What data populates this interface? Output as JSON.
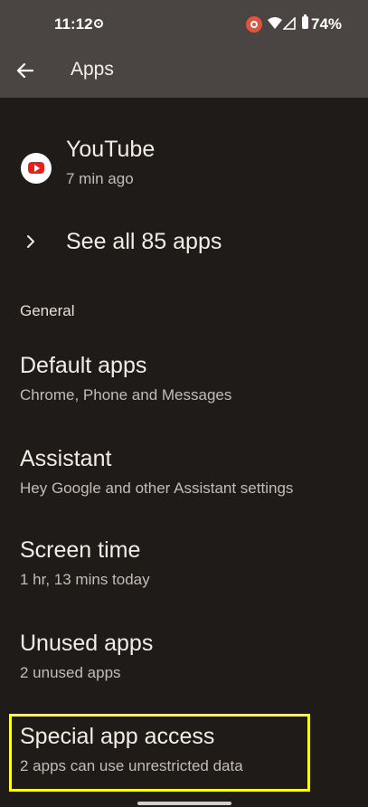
{
  "status_bar": {
    "time": "11:12",
    "battery": "74%"
  },
  "app_bar": {
    "title": "Apps"
  },
  "recent_apps": [
    {
      "name": "YouTube",
      "last_used": "7 min ago",
      "icon": "youtube-icon"
    }
  ],
  "see_all_label": "See all 85 apps",
  "section_general": "General",
  "settings": [
    {
      "title": "Default apps",
      "subtitle": "Chrome, Phone and Messages"
    },
    {
      "title": "Assistant",
      "subtitle": "Hey Google and other Assistant settings"
    },
    {
      "title": "Screen time",
      "subtitle": "1 hr, 13 mins today"
    },
    {
      "title": "Unused apps",
      "subtitle": "2 unused apps"
    },
    {
      "title": "Special app access",
      "subtitle": "2 apps can use unrestricted data"
    }
  ],
  "colors": {
    "background": "#1e1b19",
    "app_bar": "#4a4542",
    "highlight": "#ffff1a"
  }
}
